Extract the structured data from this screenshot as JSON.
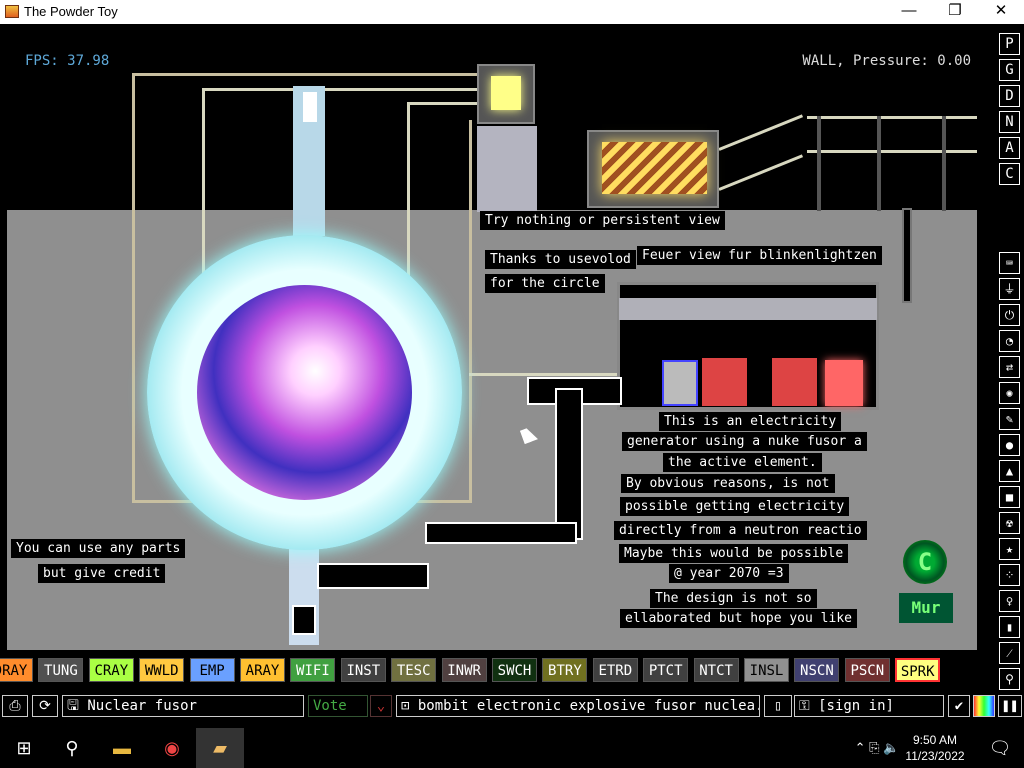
{
  "window": {
    "title": "The Powder Toy",
    "minimize": "—",
    "restore": "❐",
    "close": "✕"
  },
  "hud": {
    "fps": "FPS: 37.98",
    "pressure": "WALL, Pressure: 0.00"
  },
  "labels": {
    "try_nothing": "Try nothing or persistent view",
    "thanks": "Thanks to usevolod",
    "for_circle": "for the circle",
    "feuer": "Feuer view fur blinkenlightzen",
    "info1": "This is an electricity",
    "info2": "generator using a nuke fusor a",
    "info3": "the active element.",
    "info4": "By obvious reasons, is not",
    "info5": "possible getting electricity",
    "info6": "directly from a neutron reactio",
    "info7": "Maybe this would be possible",
    "info8": "@ year 2070 =3",
    "info9": "The design is not so",
    "info10": "ellaborated but hope you like",
    "credit1": "You can use any parts",
    "credit2": "but give credit"
  },
  "logo": {
    "c": "C",
    "mur": "Mur"
  },
  "right_top_buttons": [
    "P",
    "G",
    "D",
    "N",
    "A",
    "C"
  ],
  "right_tools": [
    "keyboard-icon",
    "plug-icon",
    "power-icon",
    "gauge-icon",
    "arrows-icon",
    "spray-icon",
    "pen-icon",
    "drop-icon",
    "flame-icon",
    "square-icon",
    "radiation-icon",
    "star-icon",
    "dots-icon",
    "bulb-icon",
    "bookmark-icon",
    "broom-icon",
    "search-icon"
  ],
  "elements": [
    {
      "name": "DRAY",
      "bg": "#ff8c2c",
      "fg": "#000"
    },
    {
      "name": "TUNG",
      "bg": "#505050",
      "fg": "#fff"
    },
    {
      "name": "CRAY",
      "bg": "#aaff44",
      "fg": "#000"
    },
    {
      "name": "WWLD",
      "bg": "#ffc840",
      "fg": "#000"
    },
    {
      "name": "EMP",
      "bg": "#6aa0ff",
      "fg": "#000"
    },
    {
      "name": "ARAY",
      "bg": "#ffc030",
      "fg": "#000"
    },
    {
      "name": "WIFI",
      "bg": "#40a040",
      "fg": "#fff"
    },
    {
      "name": "INST",
      "bg": "#404040",
      "fg": "#fff"
    },
    {
      "name": "TESC",
      "bg": "#707040",
      "fg": "#fff"
    },
    {
      "name": "INWR",
      "bg": "#504040",
      "fg": "#fff"
    },
    {
      "name": "SWCH",
      "bg": "#103010",
      "fg": "#fff"
    },
    {
      "name": "BTRY",
      "bg": "#707020",
      "fg": "#fff"
    },
    {
      "name": "ETRD",
      "bg": "#404040",
      "fg": "#fff"
    },
    {
      "name": "PTCT",
      "bg": "#404040",
      "fg": "#fff"
    },
    {
      "name": "NTCT",
      "bg": "#404040",
      "fg": "#fff"
    },
    {
      "name": "INSL",
      "bg": "#909090",
      "fg": "#000"
    },
    {
      "name": "NSCN",
      "bg": "#404070",
      "fg": "#fff"
    },
    {
      "name": "PSCN",
      "bg": "#703030",
      "fg": "#fff"
    },
    {
      "name": "SPRK",
      "bg": "#ffff80",
      "fg": "#000"
    }
  ],
  "bottom": {
    "save_name": "Nuclear fusor",
    "vote": "Vote",
    "tags": "bombit electronic explosive fusor nuclea...",
    "sign_in": "[sign in]"
  },
  "taskbar": {
    "time": "9:50 AM",
    "date": "11/23/2022"
  }
}
